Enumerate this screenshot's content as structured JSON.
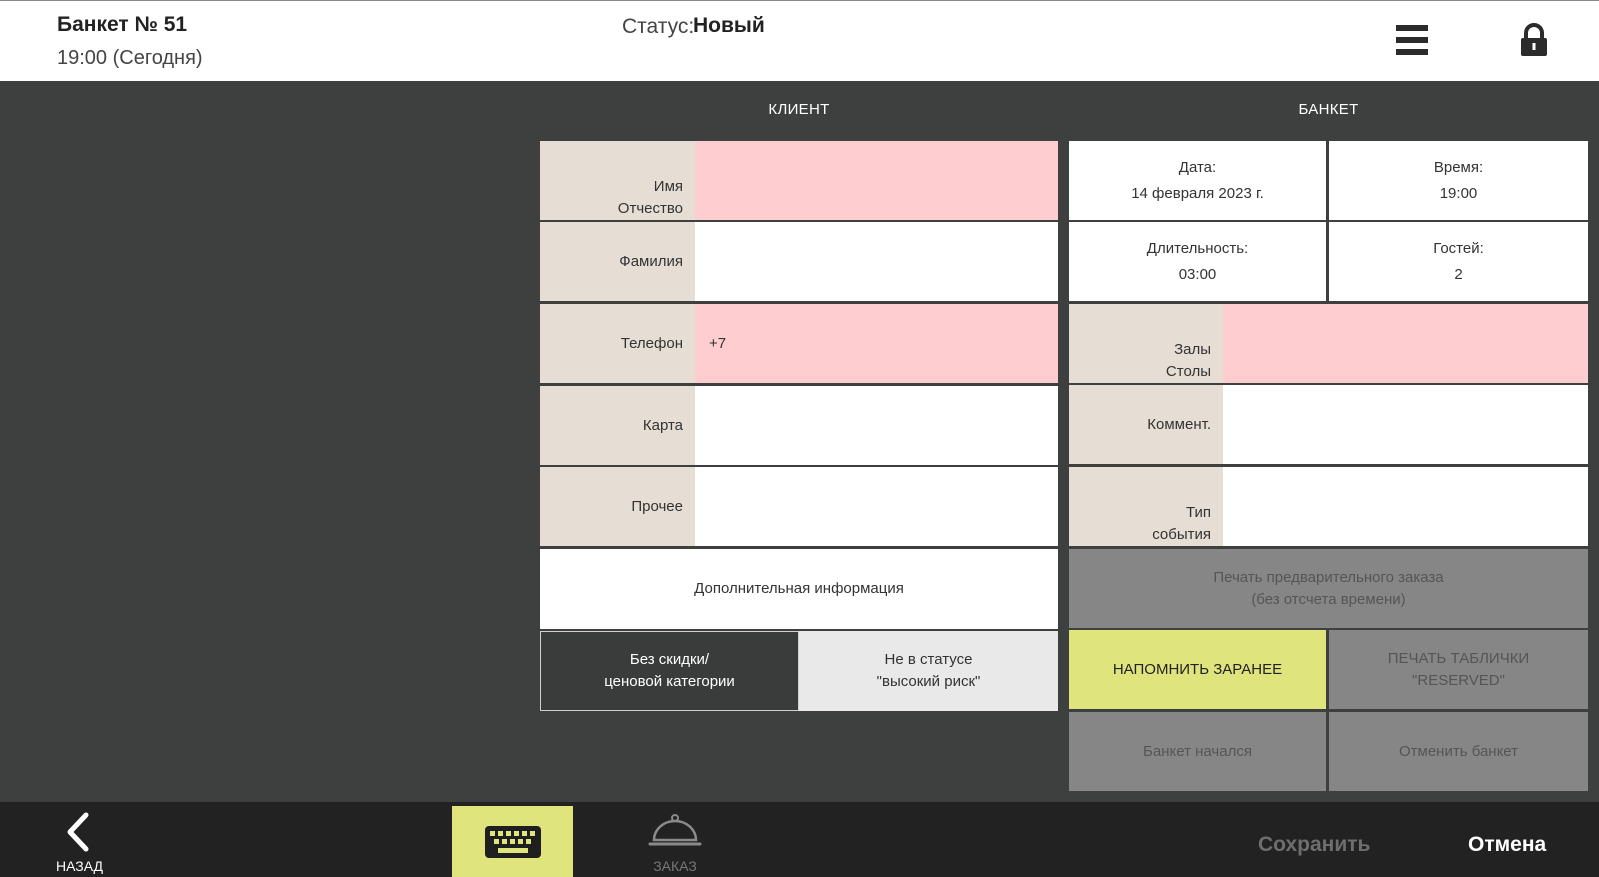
{
  "header": {
    "title": "Банкет № 51",
    "subtitle": "19:00 (Сегодня)",
    "status_label": "Статус:",
    "status_value": "Новый"
  },
  "client": {
    "section_title": "КЛИЕНТ",
    "name_label_line1": "Имя",
    "name_label_line2": "Отчество",
    "name_value": "",
    "surname_label": "Фамилия",
    "surname_value": "",
    "phone_label": "Телефон",
    "phone_value": "+7",
    "card_label": "Карта",
    "card_value": "",
    "other_label": "Прочее",
    "other_value": "",
    "additional_info": "Дополнительная информация",
    "discount_line1": "Без скидки/",
    "discount_line2": "ценовой категории",
    "risk_line1": "Не в статусе",
    "risk_line2": "\"высокий риск\""
  },
  "banquet": {
    "section_title": "БАНКЕТ",
    "date_label": "Дата:",
    "date_value": "14 февраля 2023 г.",
    "time_label": "Время:",
    "time_value": "19:00",
    "duration_label": "Длительность:",
    "duration_value": "03:00",
    "guests_label": "Гостей:",
    "guests_value": "2",
    "halls_label_line1": "Залы",
    "halls_label_line2": "Столы",
    "halls_value": "",
    "comment_label": "Коммент.",
    "comment_value": "",
    "event_label_line1": "Тип",
    "event_label_line2": "события",
    "event_value": "",
    "print_preorder_line1": "Печать предварительного заказа",
    "print_preorder_line2": "(без отсчета времени)",
    "remind_label": "НАПОМНИТЬ ЗАРАНЕЕ",
    "print_reserved_line1": "ПЕЧАТЬ ТАБЛИЧКИ",
    "print_reserved_line2": "\"RESERVED\"",
    "started_label": "Банкет начался",
    "cancel_banquet_label": "Отменить банкет"
  },
  "footer": {
    "back_label": "НАЗАД",
    "order_label": "ЗАКАЗ",
    "save_label": "Сохранить",
    "cancel_label": "Отмена"
  },
  "icons": {
    "menu": "hamburger-icon",
    "lock": "lock-icon",
    "back": "chevron-left-icon",
    "keyboard": "keyboard-icon",
    "order": "cloche-icon"
  },
  "colors": {
    "background": "#3e4040",
    "label_bg": "#e6ddd5",
    "required_field": "#fdcdd0",
    "accent_yellow": "#dfe47c",
    "disabled_gray": "#868686",
    "footer": "#222222"
  }
}
